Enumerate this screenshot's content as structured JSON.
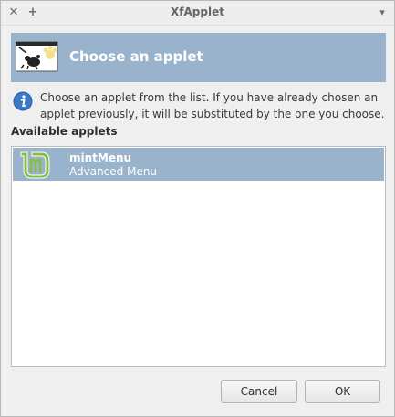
{
  "window": {
    "title": "XfApplet"
  },
  "titlebar": {
    "close_glyph": "✕",
    "pin_glyph": "+",
    "menu_glyph": "▾"
  },
  "banner": {
    "title": "Choose an applet"
  },
  "info": {
    "text": "Choose an applet from the list. If you have already chosen an applet previously, it will be substituted by the one you choose."
  },
  "list": {
    "label": "Available applets",
    "items": [
      {
        "name": "mintMenu",
        "description": "Advanced Menu",
        "icon": "mint-logo-icon",
        "selected": true
      }
    ]
  },
  "buttons": {
    "cancel": "Cancel",
    "ok": "OK"
  },
  "colors": {
    "selection": "#99b3cd",
    "mint_green": "#86be43",
    "info_blue": "#3a79c4"
  }
}
